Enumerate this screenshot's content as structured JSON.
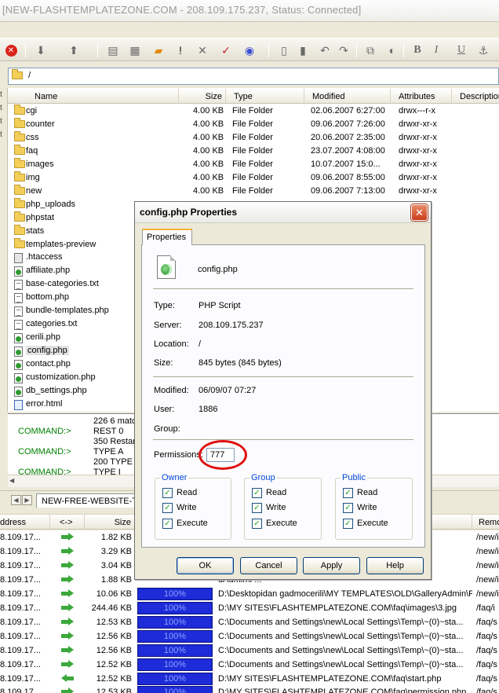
{
  "window": {
    "title": "[NEW-FLASHTEMPLATEZONE.COM - 208.109.175.237, Status: Connected]"
  },
  "path": {
    "value": "/"
  },
  "list": {
    "columns": [
      "Name",
      "Size",
      "Type",
      "Modified",
      "Attributes",
      "Description"
    ],
    "rows": [
      {
        "icon": "folder",
        "name": "cgi",
        "size": "4.00 KB",
        "type": "File Folder",
        "modified": "02.06.2007 6:27:00",
        "attr": "drwx---r-x"
      },
      {
        "icon": "folder",
        "name": "counter",
        "size": "4.00 KB",
        "type": "File Folder",
        "modified": "09.06.2007 7:26:00",
        "attr": "drwxr-xr-x"
      },
      {
        "icon": "folder",
        "name": "css",
        "size": "4.00 KB",
        "type": "File Folder",
        "modified": "20.06.2007 2:35:00",
        "attr": "drwxr-xr-x"
      },
      {
        "icon": "folder",
        "name": "faq",
        "size": "4.00 KB",
        "type": "File Folder",
        "modified": "23.07.2007 4:08:00",
        "attr": "drwxr-xr-x"
      },
      {
        "icon": "folder",
        "name": "images",
        "size": "4.00 KB",
        "type": "File Folder",
        "modified": "10.07.2007 15:0...",
        "attr": "drwxr-xr-x"
      },
      {
        "icon": "folder",
        "name": "img",
        "size": "4.00 KB",
        "type": "File Folder",
        "modified": "09.06.2007 8:55:00",
        "attr": "drwxr-xr-x"
      },
      {
        "icon": "folder",
        "name": "new",
        "size": "4.00 KB",
        "type": "File Folder",
        "modified": "09.06.2007 7:13:00",
        "attr": "drwxr-xr-x"
      },
      {
        "icon": "folder",
        "name": "php_uploads",
        "size": "",
        "type": "",
        "modified": "",
        "attr": ""
      },
      {
        "icon": "folder",
        "name": "phpstat",
        "size": "",
        "type": "",
        "modified": "",
        "attr": ""
      },
      {
        "icon": "folder",
        "name": "stats",
        "size": "",
        "type": "",
        "modified": "",
        "attr": "x"
      },
      {
        "icon": "folder",
        "name": "templates-preview",
        "size": "",
        "type": "",
        "modified": "",
        "attr": "x"
      },
      {
        "icon": "ht",
        "name": ".htaccess",
        "size": "",
        "type": "",
        "modified": "",
        "attr": ""
      },
      {
        "icon": "php",
        "name": "affiliate.php",
        "size": "",
        "type": "",
        "modified": "",
        "attr": ""
      },
      {
        "icon": "txt",
        "name": "base-categories.txt",
        "size": "",
        "type": "",
        "modified": "",
        "attr": ""
      },
      {
        "icon": "txt",
        "name": "bottom.php",
        "size": "",
        "type": "",
        "modified": "",
        "attr": ""
      },
      {
        "icon": "txt",
        "name": "bundle-templates.php",
        "size": "",
        "type": "",
        "modified": "",
        "attr": ""
      },
      {
        "icon": "txt",
        "name": "categories.txt",
        "size": "",
        "type": "",
        "modified": "",
        "attr": ""
      },
      {
        "icon": "php",
        "name": "cerili.php",
        "size": "",
        "type": "",
        "modified": "",
        "attr": ""
      },
      {
        "icon": "php",
        "name": "config.php",
        "size": "",
        "type": "",
        "modified": "",
        "attr": ""
      },
      {
        "icon": "php",
        "name": "contact.php",
        "size": "",
        "type": "",
        "modified": "",
        "attr": ""
      },
      {
        "icon": "php",
        "name": "customization.php",
        "size": "",
        "type": "",
        "modified": "",
        "attr": ""
      },
      {
        "icon": "php",
        "name": "db_settings.php",
        "size": "",
        "type": "",
        "modified": "",
        "attr": ""
      },
      {
        "icon": "html",
        "name": "error.html",
        "size": "",
        "type": "",
        "modified": "",
        "attr": ""
      }
    ]
  },
  "console": {
    "lines": [
      {
        "cmd": "",
        "resp": "226 6 matc"
      },
      {
        "cmd": "COMMAND:>",
        "resp": "REST 0"
      },
      {
        "cmd": "",
        "resp": "350 Restar"
      },
      {
        "cmd": "COMMAND:>",
        "resp": "TYPE A"
      },
      {
        "cmd": "",
        "resp": "200 TYPE is"
      },
      {
        "cmd": "COMMAND:>",
        "resp": "TYPE I"
      }
    ]
  },
  "tabs": {
    "site_tab": "NEW-FREE-WEBSITE-TE"
  },
  "queue": {
    "columns": [
      "ddress",
      "<->",
      "Size",
      "Remo"
    ],
    "rows": [
      {
        "addr": "8.109.17...",
        "dir": "right",
        "size": "1.82 KB",
        "progress": "",
        "local": "dAdmin\\P...",
        "remote": "/new/i"
      },
      {
        "addr": "8.109.17...",
        "dir": "right",
        "size": "3.29 KB",
        "progress": "",
        "local": "dAdmin\\P...",
        "remote": "/new/i"
      },
      {
        "addr": "8.109.17...",
        "dir": "right",
        "size": "3.04 KB",
        "progress": "",
        "local": "dAdmin\\P...",
        "remote": "/new/i"
      },
      {
        "addr": "8.109.17...",
        "dir": "right",
        "size": "1.88 KB",
        "progress": "",
        "local": "dAdmin\\P...",
        "remote": "/new/i"
      },
      {
        "addr": "8.109.17...",
        "dir": "right",
        "size": "10.06 KB",
        "progress": "100%",
        "local": "D:\\Desktopidan gadmocerili\\MY TEMPLATES\\OLD\\GalleryAdmin\\P...",
        "remote": "/new/i"
      },
      {
        "addr": "8.109.17...",
        "dir": "right",
        "size": "244.46 KB",
        "progress": "100%",
        "local": "D:\\MY SITES\\FLASHTEMPLATEZONE.COM\\faq\\images\\3.jpg",
        "remote": "/faq/i"
      },
      {
        "addr": "8.109.17...",
        "dir": "right",
        "size": "12.53 KB",
        "progress": "100%",
        "local": "C:\\Documents and Settings\\new\\Local Settings\\Temp\\~(0)~sta...",
        "remote": "/faq/s"
      },
      {
        "addr": "8.109.17...",
        "dir": "right",
        "size": "12.56 KB",
        "progress": "100%",
        "local": "C:\\Documents and Settings\\new\\Local Settings\\Temp\\~(0)~sta...",
        "remote": "/faq/s"
      },
      {
        "addr": "8.109.17...",
        "dir": "right",
        "size": "12.56 KB",
        "progress": "100%",
        "local": "C:\\Documents and Settings\\new\\Local Settings\\Temp\\~(0)~sta...",
        "remote": "/faq/s"
      },
      {
        "addr": "8.109.17...",
        "dir": "right",
        "size": "12.52 KB",
        "progress": "100%",
        "local": "C:\\Documents and Settings\\new\\Local Settings\\Temp\\~(0)~sta...",
        "remote": "/faq/s"
      },
      {
        "addr": "8.109.17...",
        "dir": "left",
        "size": "12.52 KB",
        "progress": "100%",
        "local": "D:\\MY SITES\\FLASHTEMPLATEZONE.COM\\faq\\start.php",
        "remote": "/faq/s"
      },
      {
        "addr": "8.109.17...",
        "dir": "right",
        "size": "12.53 KB",
        "progress": "100%",
        "local": "D:\\MY SITES\\FLASHTEMPLATEZONE.COM\\faq\\permission.php",
        "remote": "/faq/s"
      }
    ]
  },
  "dialog": {
    "title": "config.php Properties",
    "tab": "Properties",
    "filename": "config.php",
    "type_label": "Type:",
    "type_value": "PHP Script",
    "server_label": "Server:",
    "server_value": "208.109.175.237",
    "location_label": "Location:",
    "location_value": "/",
    "size_label": "Size:",
    "size_value": "845 bytes (845 bytes)",
    "modified_label": "Modified:",
    "modified_value": "06/09/07 07:27",
    "user_label": "User:",
    "user_value": "1886",
    "group_label": "Group:",
    "group_value": "",
    "permissions_label": "Permissions:",
    "permissions_value": "777",
    "groups": [
      {
        "title": "Owner",
        "read": "Read",
        "write": "Write",
        "execute": "Execute"
      },
      {
        "title": "Group",
        "read": "Read",
        "write": "Write",
        "execute": "Execute"
      },
      {
        "title": "Public",
        "read": "Read",
        "write": "Write",
        "execute": "Execute"
      }
    ],
    "ok": "OK",
    "cancel": "Cancel",
    "apply": "Apply",
    "help": "Help"
  }
}
